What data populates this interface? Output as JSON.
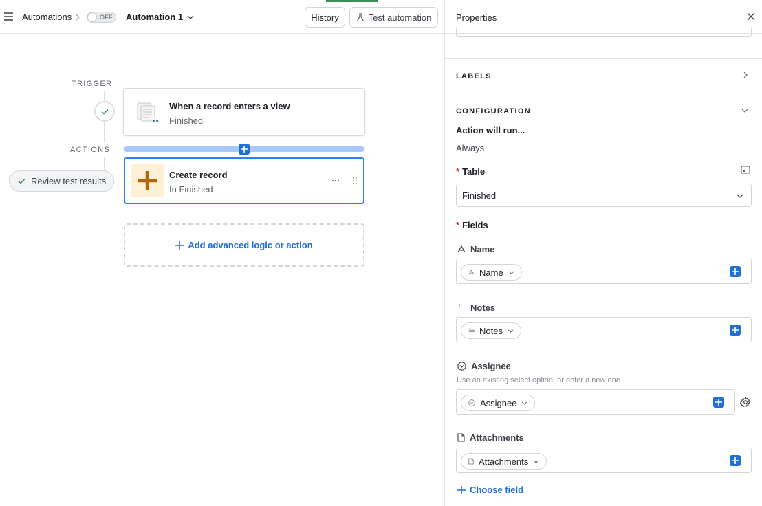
{
  "topbar": {
    "breadcrumb": "Automations",
    "toggle_label": "OFF",
    "automation_name": "Automation 1",
    "history_label": "History",
    "test_label": "Test automation"
  },
  "canvas": {
    "trigger_label": "TRIGGER",
    "actions_label": "ACTIONS",
    "trigger_card": {
      "title": "When a record enters a view",
      "subtitle": "Finished"
    },
    "action_card": {
      "title": "Create record",
      "subtitle": "In Finished"
    },
    "review_label": "Review test results",
    "add_logic_label": "Add advanced logic or action"
  },
  "panel": {
    "title": "Properties",
    "labels_section": "LABELS",
    "config_section": "CONFIGURATION",
    "action_runs_label": "Action will run...",
    "action_runs_value": "Always",
    "table_label": "Table",
    "table_value": "Finished",
    "fields_label": "Fields",
    "fields": [
      {
        "label": "Name",
        "chip": "Name",
        "icon": "text-icon"
      },
      {
        "label": "Notes",
        "chip": "Notes",
        "icon": "long-text-icon"
      },
      {
        "label": "Assignee",
        "chip": "Assignee",
        "icon": "select-icon",
        "hint": "Use an existing select option, or enter a new one"
      },
      {
        "label": "Attachments",
        "chip": "Attachments",
        "icon": "attachment-icon"
      }
    ],
    "choose_field_label": "Choose field"
  },
  "colors": {
    "accent": "#1f6fd8",
    "selected_border": "#2d7ff9",
    "action_icon_bg": "#fdf0d5",
    "action_icon": "#b5650a"
  }
}
